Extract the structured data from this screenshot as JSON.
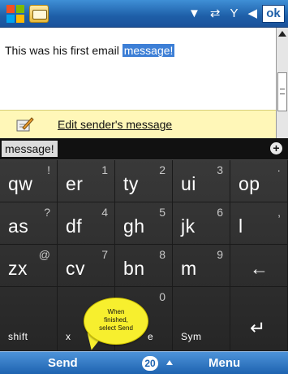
{
  "title_bar": {
    "start_icon": "windows-flag-icon",
    "app_icon": "email-app-icon",
    "status_icons": [
      "signal-triangle-icon",
      "sync-arrows-icon",
      "antenna-icon",
      "speaker-icon"
    ],
    "ok_label": "ok"
  },
  "message": {
    "text_before": "This was his first email",
    "selected_text": "message!"
  },
  "edit_sender": {
    "label": "Edit sender's message",
    "icon": "pencil-note-icon"
  },
  "keyboard": {
    "input_text": "message!",
    "add_icon": "plus-icon",
    "rows": [
      [
        {
          "main": "qw",
          "alt": "!"
        },
        {
          "main": "er",
          "alt": "1"
        },
        {
          "main": "ty",
          "alt": "2"
        },
        {
          "main": "ui",
          "alt": "3"
        },
        {
          "main": "op",
          "alt": "·"
        }
      ],
      [
        {
          "main": "as",
          "alt": "?"
        },
        {
          "main": "df",
          "alt": "4"
        },
        {
          "main": "gh",
          "alt": "5"
        },
        {
          "main": "jk",
          "alt": "6"
        },
        {
          "main": "l",
          "alt": ","
        }
      ],
      [
        {
          "main": "zx",
          "alt": "@"
        },
        {
          "main": "cv",
          "alt": "7"
        },
        {
          "main": "bn",
          "alt": "8"
        },
        {
          "main": "m",
          "alt": "9"
        },
        {
          "main": "←",
          "alt": ""
        }
      ],
      [
        {
          "main": "shift",
          "alt": ""
        },
        {
          "main": "x",
          "alt": ""
        },
        {
          "main": "e",
          "alt": "0"
        },
        {
          "main": "Sym",
          "alt": ""
        },
        {
          "main": "↵",
          "alt": ""
        }
      ]
    ]
  },
  "tooltip": {
    "text_line1": "When",
    "text_line2": "finished,",
    "text_line3": "select Send"
  },
  "softkeys": {
    "left": "Send",
    "center_badge": "20",
    "right": "Menu"
  },
  "colors": {
    "titlebar": "#1e5fa8",
    "selection": "#3d7fd6",
    "edit_bar": "#fff7b8",
    "keyboard_bg": "#2f2f2f",
    "tooltip": "#f7ef2e"
  }
}
